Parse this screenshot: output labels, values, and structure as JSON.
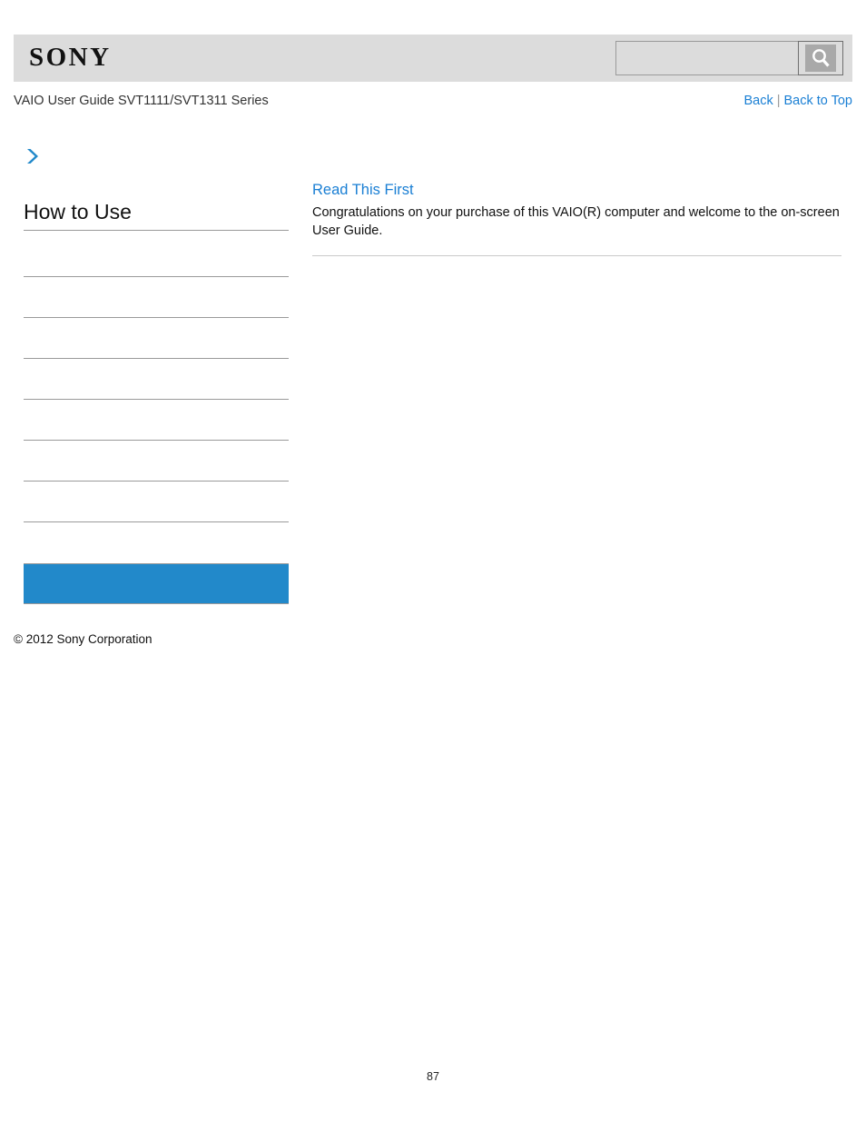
{
  "header": {
    "logo_text": "SONY",
    "logo_icon": "sony-wordmark",
    "guide_title": "VAIO User Guide SVT1111/SVT1311 Series"
  },
  "search": {
    "value": "",
    "placeholder": "",
    "button_icon": "search-icon",
    "button_label": "Search"
  },
  "nav": {
    "back_label": "Back",
    "separator": "|",
    "back_to_top_label": "Back to Top"
  },
  "sidebar": {
    "chevron_icon": "chevron-right-icon",
    "heading": "How to Use",
    "items": [
      {
        "label": "",
        "selected": false
      },
      {
        "label": "",
        "selected": false
      },
      {
        "label": "",
        "selected": false
      },
      {
        "label": "",
        "selected": false
      },
      {
        "label": "",
        "selected": false
      },
      {
        "label": "",
        "selected": false
      },
      {
        "label": "",
        "selected": false
      },
      {
        "label": "",
        "selected": false
      },
      {
        "label": "",
        "selected": true
      }
    ],
    "copyright": "© 2012 Sony Corporation"
  },
  "content": {
    "title": "Read This First",
    "body": "Congratulations on your purchase of this VAIO(R) computer and welcome to the on-screen User Guide."
  },
  "footer": {
    "page_number": "87"
  },
  "colors": {
    "header_bar": "#dcdcdc",
    "link_blue": "#1a7fd4",
    "selected_blue": "#2289ca",
    "rule_gray": "#9a9a9a",
    "content_rule_gray": "#c9c9c9"
  }
}
